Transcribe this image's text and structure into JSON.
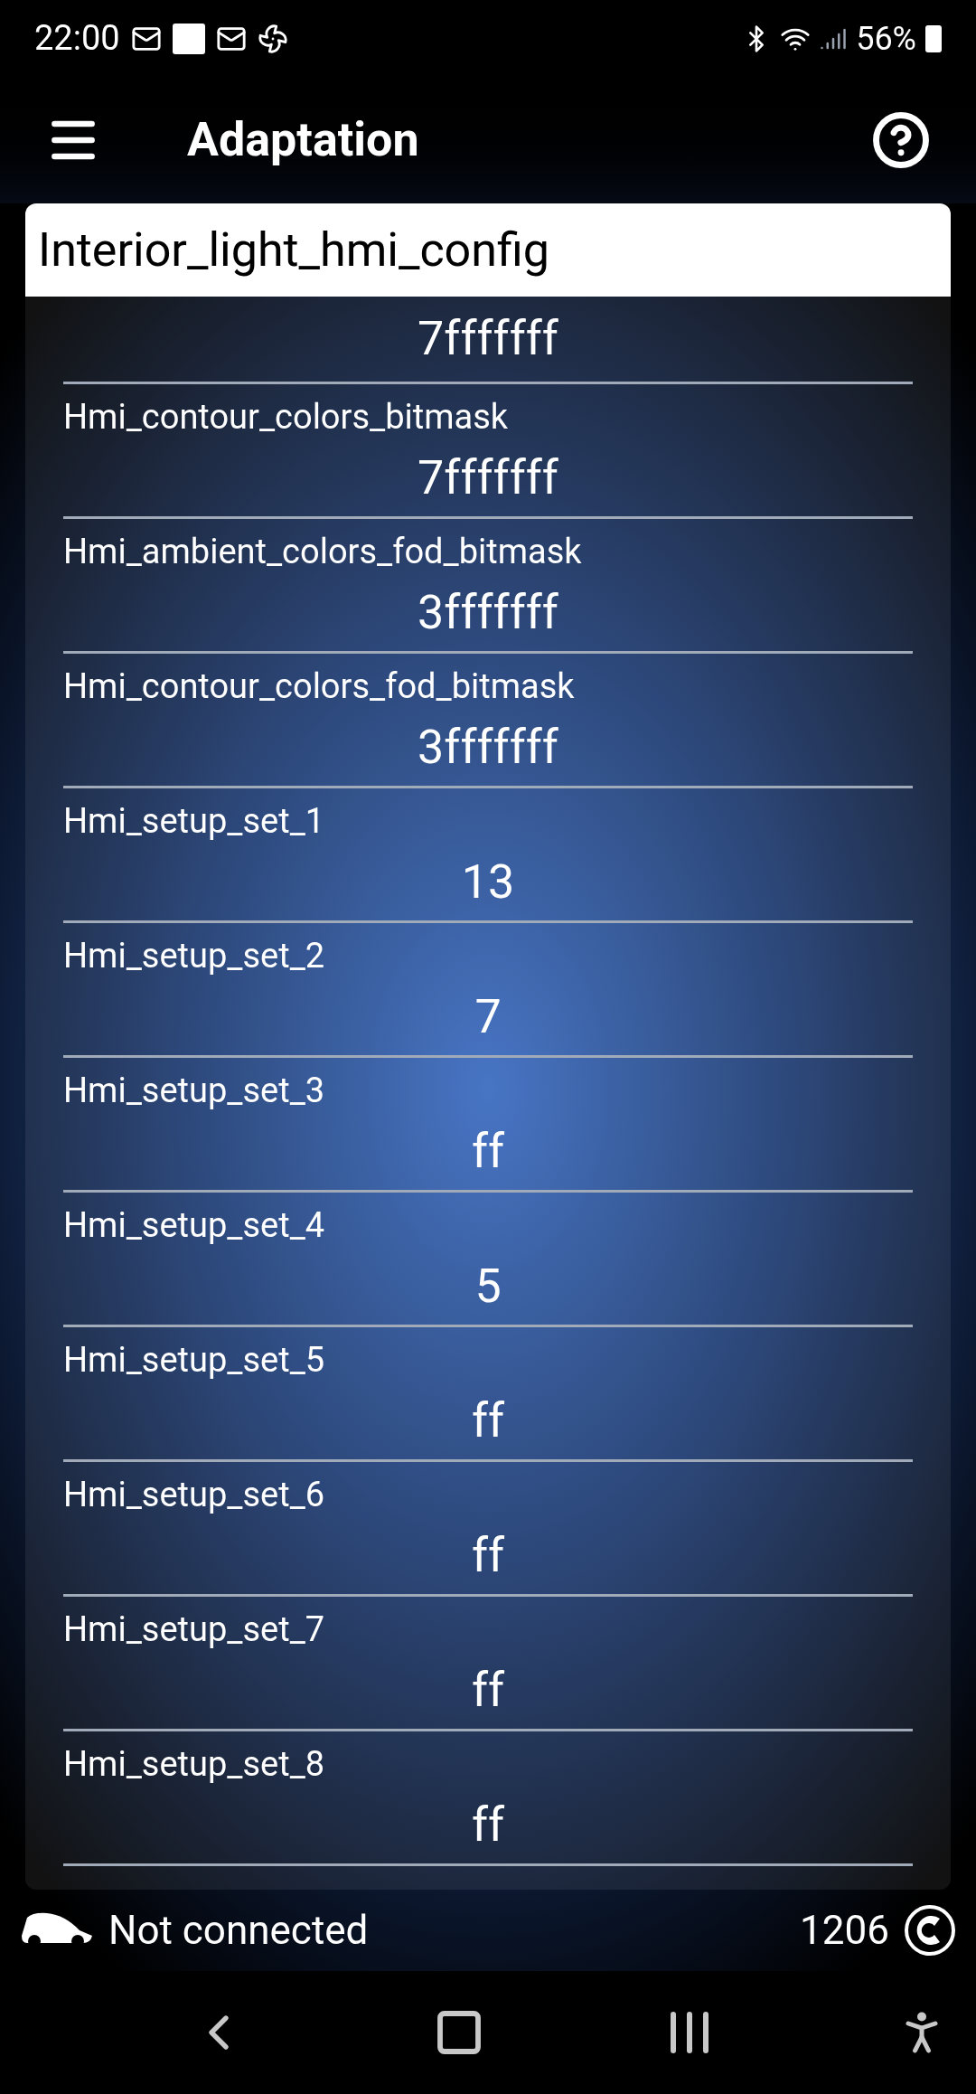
{
  "status_bar": {
    "time": "22:00",
    "battery": "56%"
  },
  "app_bar": {
    "title": "Adaptation"
  },
  "panel": {
    "title": "Interior_light_hmi_config",
    "rows": [
      {
        "value": "7fffffff"
      },
      {
        "label": "Hmi_contour_colors_bitmask",
        "value": "7fffffff"
      },
      {
        "label": "Hmi_ambient_colors_fod_bitmask",
        "value": "3fffffff"
      },
      {
        "label": "Hmi_contour_colors_fod_bitmask",
        "value": "3fffffff"
      },
      {
        "label": "Hmi_setup_set_1",
        "value": "13"
      },
      {
        "label": "Hmi_setup_set_2",
        "value": "7"
      },
      {
        "label": "Hmi_setup_set_3",
        "value": "ff"
      },
      {
        "label": "Hmi_setup_set_4",
        "value": "5"
      },
      {
        "label": "Hmi_setup_set_5",
        "value": "ff"
      },
      {
        "label": "Hmi_setup_set_6",
        "value": "ff"
      },
      {
        "label": "Hmi_setup_set_7",
        "value": "ff"
      },
      {
        "label": "Hmi_setup_set_8",
        "value": "ff"
      }
    ]
  },
  "footer": {
    "connection": "Not connected",
    "count": "1206"
  }
}
